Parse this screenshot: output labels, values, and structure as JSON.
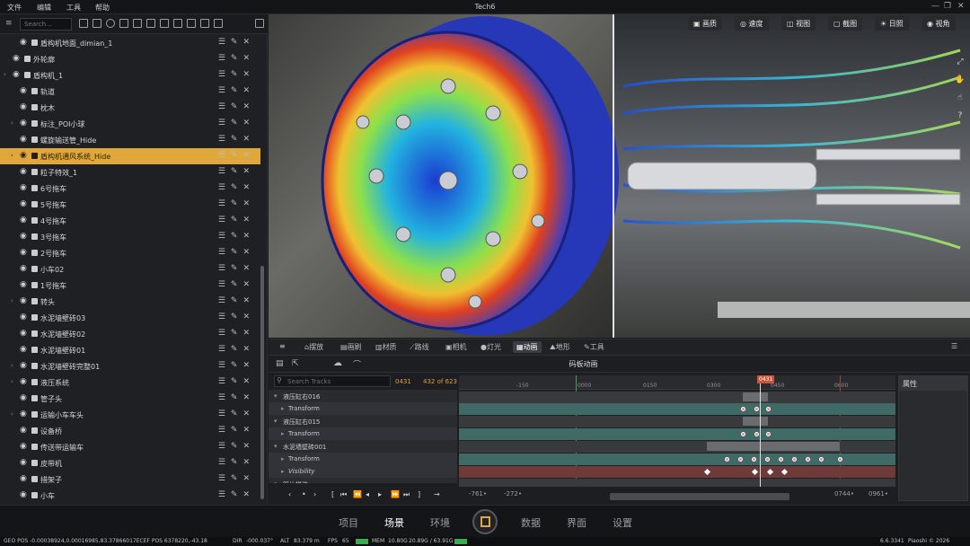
{
  "window": {
    "title": "Tech6"
  },
  "menu": [
    "文件",
    "编辑",
    "工具",
    "帮助"
  ],
  "outliner": {
    "search_placeholder": "Search...",
    "items": [
      {
        "label": "盾构机地面_dimian_1",
        "depth": 2,
        "arrow": false
      },
      {
        "label": "外轮廓",
        "depth": 1,
        "arrow": false
      },
      {
        "label": "盾构机_1",
        "depth": 1,
        "arrow": true
      },
      {
        "label": "轨道",
        "depth": 2,
        "arrow": false
      },
      {
        "label": "枕木",
        "depth": 2,
        "arrow": false
      },
      {
        "label": "标注_POI小球",
        "depth": 2,
        "arrow": true
      },
      {
        "label": "螺旋输送管_Hide",
        "depth": 2,
        "arrow": false
      },
      {
        "label": "盾构机通风系统_Hide",
        "depth": 2,
        "arrow": true,
        "selected": true
      },
      {
        "label": "粒子特效_1",
        "depth": 2,
        "arrow": false
      },
      {
        "label": "6号拖车",
        "depth": 2,
        "arrow": false
      },
      {
        "label": "5号拖车",
        "depth": 2,
        "arrow": false
      },
      {
        "label": "4号拖车",
        "depth": 2,
        "arrow": false
      },
      {
        "label": "3号拖车",
        "depth": 2,
        "arrow": false
      },
      {
        "label": "2号拖车",
        "depth": 2,
        "arrow": false
      },
      {
        "label": "小车02",
        "depth": 2,
        "arrow": false
      },
      {
        "label": "1号拖车",
        "depth": 2,
        "arrow": false
      },
      {
        "label": "转头",
        "depth": 2,
        "arrow": true
      },
      {
        "label": "水泥墙壁砖03",
        "depth": 2,
        "arrow": false
      },
      {
        "label": "水泥墙壁砖02",
        "depth": 2,
        "arrow": false
      },
      {
        "label": "水泥墙壁砖01",
        "depth": 2,
        "arrow": false
      },
      {
        "label": "水泥墙壁砖完整01",
        "depth": 2,
        "arrow": true
      },
      {
        "label": "液压系统",
        "depth": 2,
        "arrow": true
      },
      {
        "label": "管子头",
        "depth": 2,
        "arrow": false
      },
      {
        "label": "运输小车车头",
        "depth": 2,
        "arrow": true
      },
      {
        "label": "设备桥",
        "depth": 2,
        "arrow": false
      },
      {
        "label": "传送带运输车",
        "depth": 2,
        "arrow": false
      },
      {
        "label": "皮带机",
        "depth": 2,
        "arrow": false
      },
      {
        "label": "措架子",
        "depth": 2,
        "arrow": false
      },
      {
        "label": "小车",
        "depth": 2,
        "arrow": false
      }
    ]
  },
  "viewport": {
    "tabs": [
      "画质",
      "速度",
      "视图",
      "截图",
      "日照",
      "视角"
    ]
  },
  "animation": {
    "tabs": [
      "摆放",
      "画刷",
      "材质",
      "路线",
      "相机",
      "灯光",
      "动画",
      "地形",
      "工具"
    ],
    "active_tab": "动画",
    "title": "码板动画",
    "track_search_placeholder": "Search Tracks",
    "frame_current": "0431",
    "frame_range": "432 of 623",
    "tracks": [
      {
        "label": "液压缸右016",
        "kind": "group"
      },
      {
        "label": "Transform",
        "kind": "child"
      },
      {
        "label": "液压缸右015",
        "kind": "group"
      },
      {
        "label": "Transform",
        "kind": "child"
      },
      {
        "label": "水泥墙壁砖001",
        "kind": "group"
      },
      {
        "label": "Transform",
        "kind": "child"
      },
      {
        "label": "Visibility",
        "kind": "child"
      },
      {
        "label": "管片拼装",
        "kind": "group"
      }
    ],
    "ruler_ticks": [
      "-150",
      "0000",
      "0150",
      "0300",
      "0450",
      "0600"
    ],
    "playhead_label": "0431",
    "range_start": "-761•",
    "range_end": "-272•",
    "range_end2": "0744•",
    "range_end3": "0961•",
    "properties_title": "属性"
  },
  "bottom_nav": {
    "items": [
      "项目",
      "场景",
      "环境",
      "数据",
      "界面",
      "设置"
    ],
    "active": "场景"
  },
  "status": {
    "geo": "GEO POS -0.00038924,0.00016985,83.37866017ECEF POS 6378220,-43.18",
    "dir_label": "DIR",
    "dir": "-000.037°",
    "alt_label": "ALT",
    "alt": "83.379 m",
    "fps_label": "FPS",
    "fps": "65",
    "mem_label": "MEM",
    "mem": "10.80G",
    "vram": "20.89G / 63.91G",
    "version": "6.6.3341",
    "copyright": "Piaoshi © 2026"
  },
  "colors": {
    "accent": "#e0a83a",
    "selected_row": "#e0a83a"
  }
}
